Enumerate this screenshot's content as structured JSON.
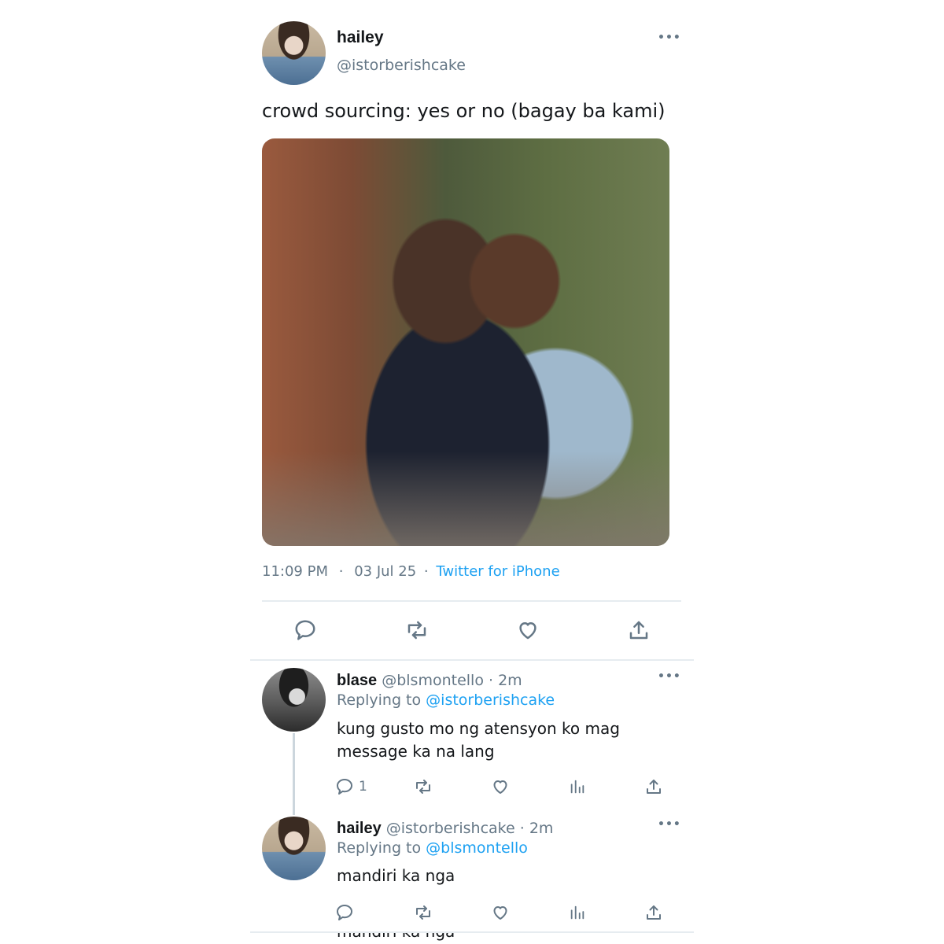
{
  "tweet": {
    "author_name": "hailey",
    "author_handle": "@istorberishcake",
    "text": "crowd sourcing: yes or no (bagay ba kami)",
    "time": "11:09 PM",
    "dot": "·",
    "date": "03 Jul 25",
    "source_sep": "·",
    "source": "Twitter for iPhone",
    "more_label": "•••"
  },
  "replies": [
    {
      "author_name": "blase",
      "author_handle": "@blsmontello",
      "age": "· 2m",
      "replying_prefix": "Replying to",
      "replying_to": "@istorberishcake",
      "text": "kung gusto mo ng atensyon ko mag message ka na lang",
      "reply_count": "1",
      "more_label": "•••"
    },
    {
      "author_name": "hailey",
      "author_handle": "@istorberishcake",
      "age": "· 2m",
      "replying_prefix": "Replying to",
      "replying_to": "@blsmontello",
      "text": "mandiri ka nga",
      "reply_count": "",
      "more_label": "•••"
    }
  ],
  "cut_off_text": "mandiri ka nga",
  "icons": [
    "reply-icon",
    "retweet-icon",
    "like-icon",
    "share-icon",
    "analytics-icon",
    "more-icon"
  ],
  "colors": {
    "link": "#1da1f2",
    "muted": "#657786",
    "text": "#14171a"
  }
}
